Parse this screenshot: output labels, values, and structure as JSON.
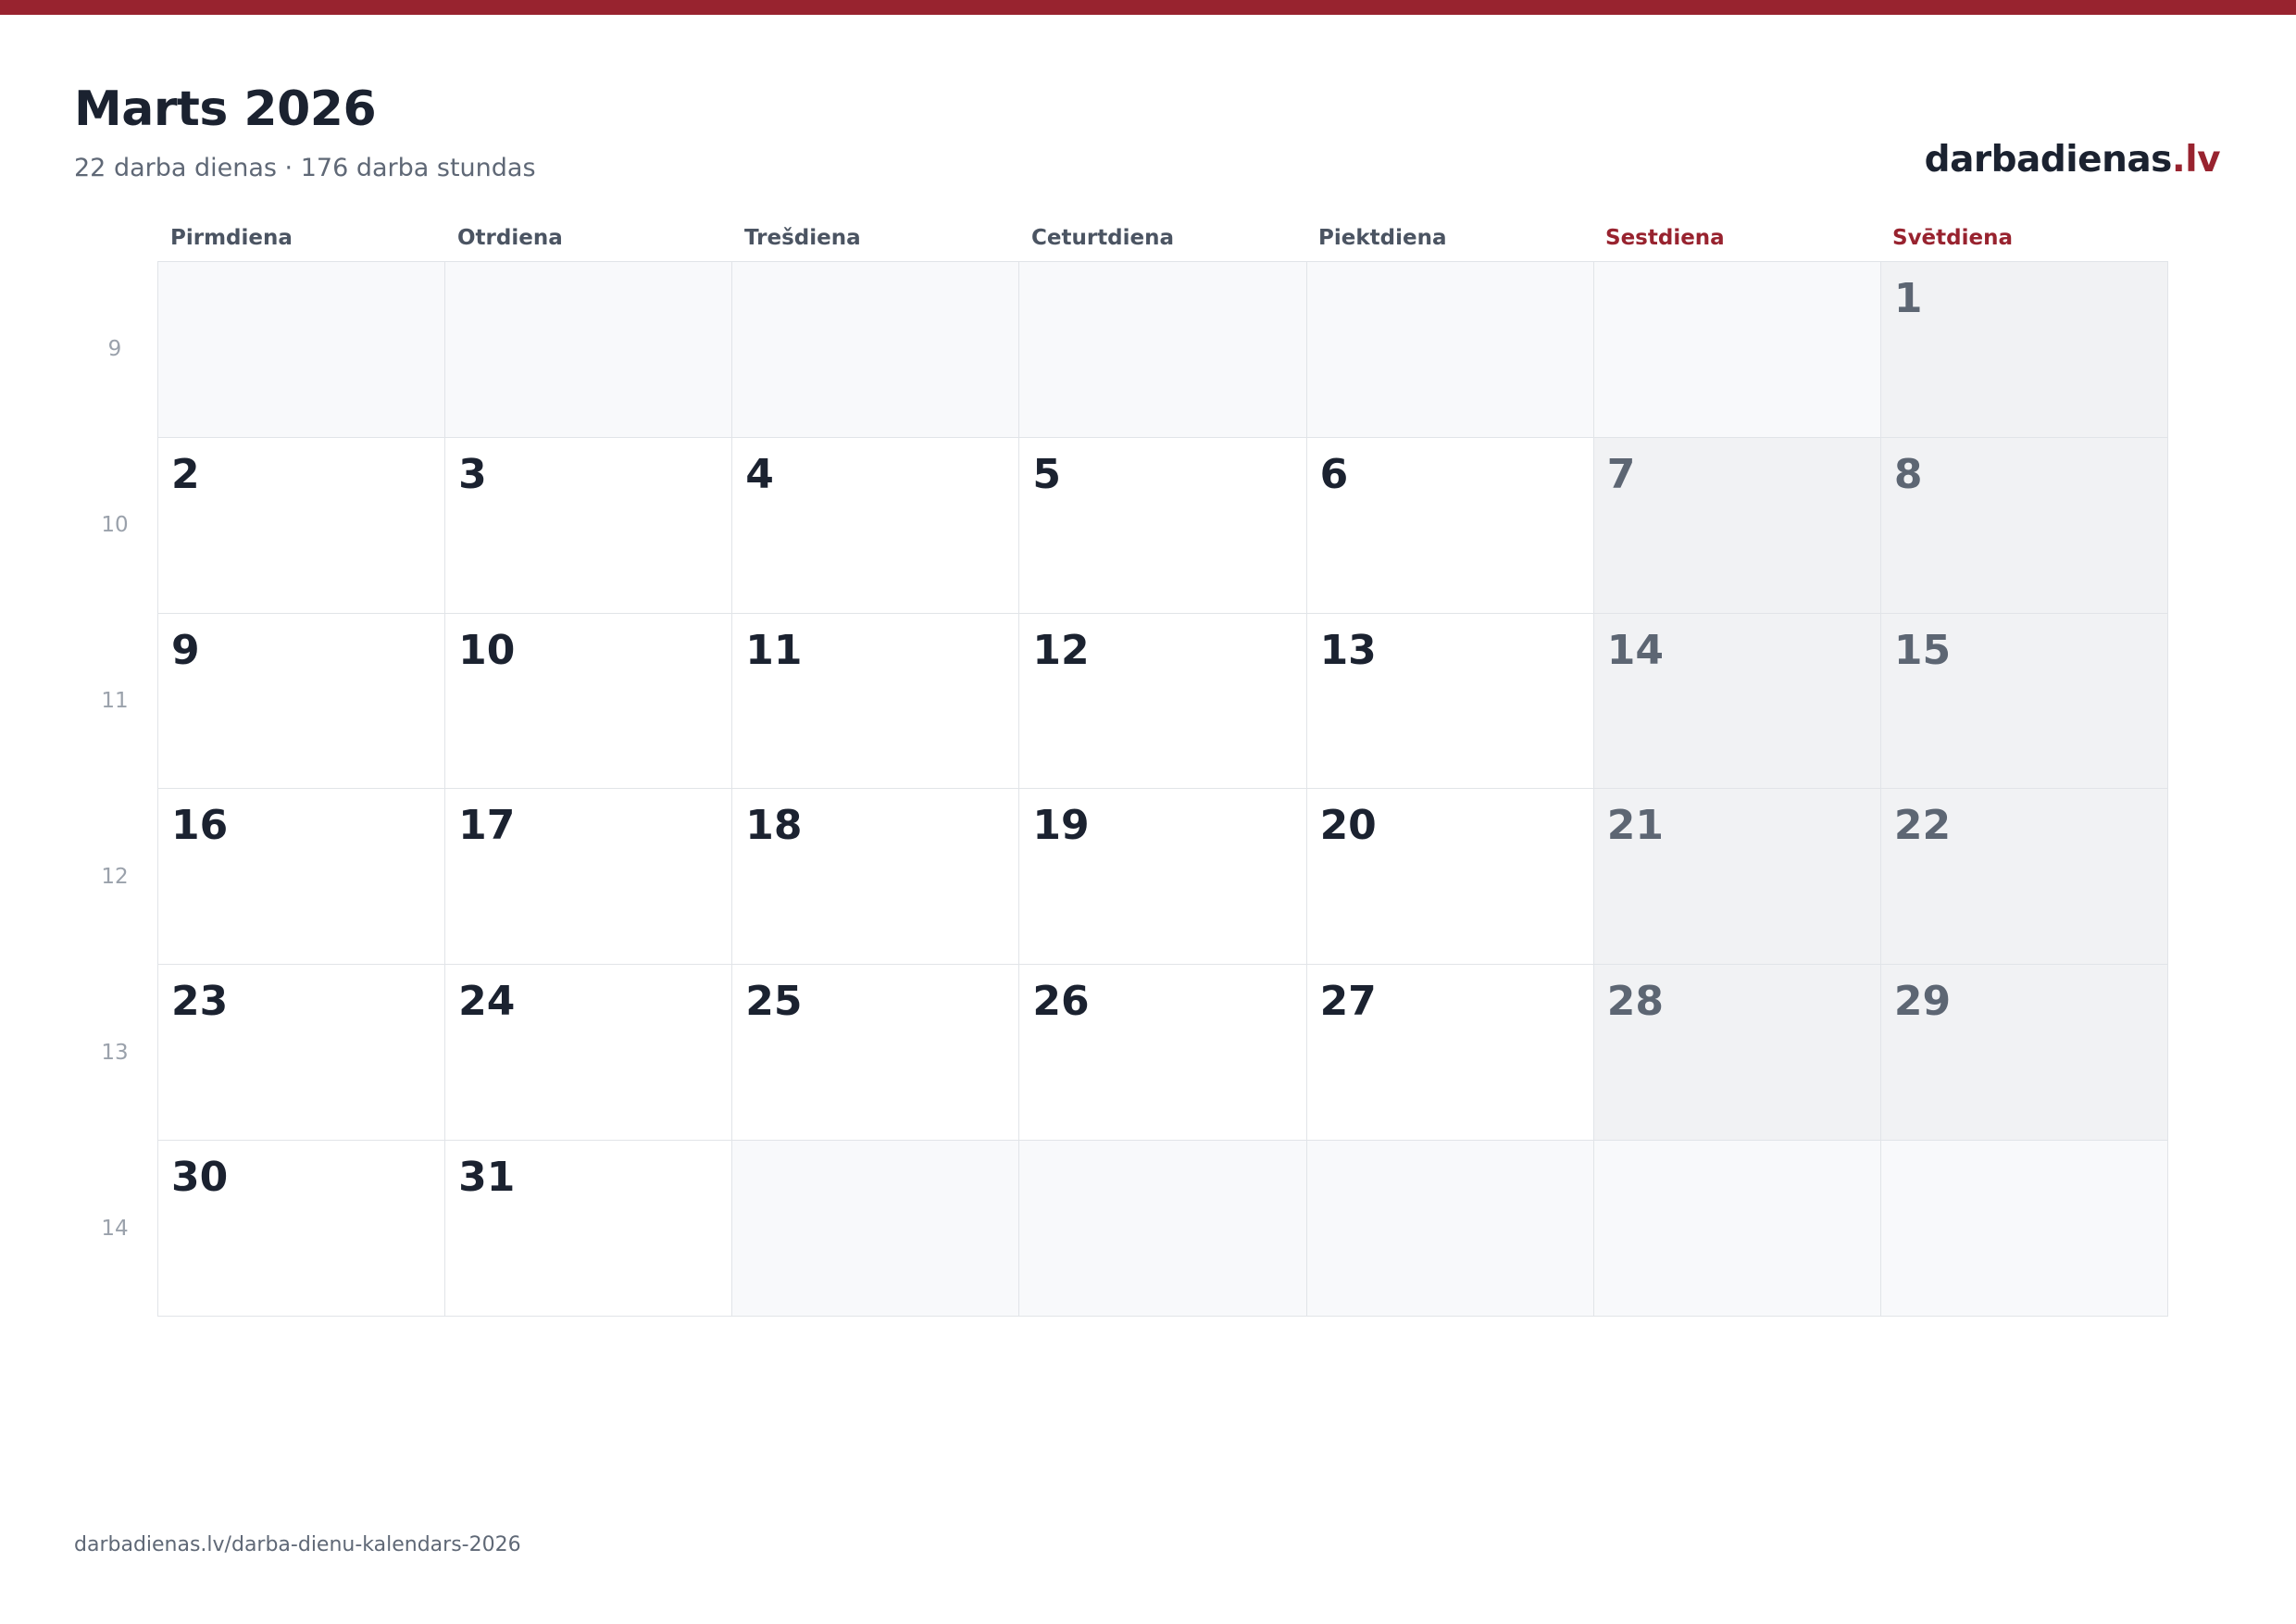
{
  "header": {
    "title": "Marts 2026",
    "subtitle": "22 darba dienas · 176 darba stundas",
    "brand_name": "darbadienas",
    "brand_tld": ".lv"
  },
  "weekdays": [
    "Pirmdiena",
    "Otrdiena",
    "Trešdiena",
    "Ceturtdiena",
    "Piektdiena",
    "Sestdiena",
    "Svētdiena"
  ],
  "week_numbers": [
    "9",
    "10",
    "11",
    "12",
    "13",
    "14"
  ],
  "weeks": [
    [
      "",
      "",
      "",
      "",
      "",
      "",
      "1"
    ],
    [
      "2",
      "3",
      "4",
      "5",
      "6",
      "7",
      "8"
    ],
    [
      "9",
      "10",
      "11",
      "12",
      "13",
      "14",
      "15"
    ],
    [
      "16",
      "17",
      "18",
      "19",
      "20",
      "21",
      "22"
    ],
    [
      "23",
      "24",
      "25",
      "26",
      "27",
      "28",
      "29"
    ],
    [
      "30",
      "31",
      "",
      "",
      "",
      "",
      ""
    ]
  ],
  "colors": {
    "accent": "#98232f",
    "weekend_bg": "#f1f2f4",
    "empty_bg": "#f8f9fb"
  },
  "footer": {
    "url": "darbadienas.lv/darba-dienu-kalendars-2026"
  }
}
